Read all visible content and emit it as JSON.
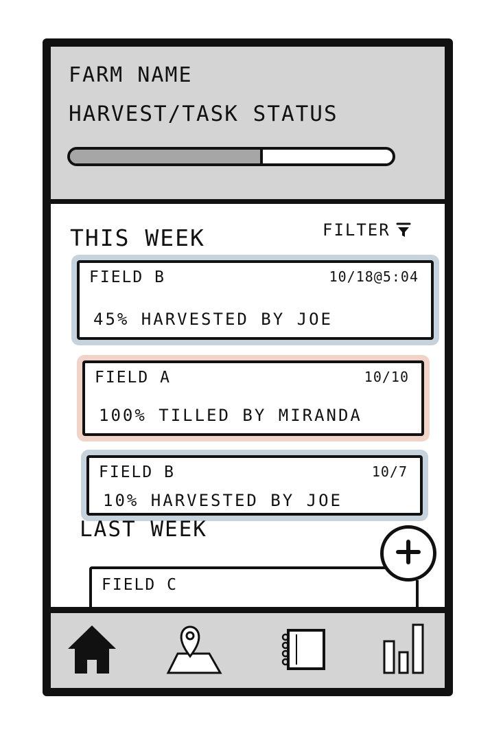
{
  "header": {
    "farm_name": "FARM NAME",
    "status_title": "HARVEST/TASK STATUS",
    "progress_fraction": 0.59
  },
  "this_week": {
    "title": "THIS WEEK",
    "filter_label": "FILTER",
    "filter_icon": "funnel-icon",
    "cards": [
      {
        "field": "FIELD B",
        "date": "10/18@5:04",
        "detail": "45% HARVESTED BY JOE",
        "accent": "#c6d3dc"
      },
      {
        "field": "FIELD A",
        "date": "10/10",
        "detail": "100% TILLED BY MIRANDA",
        "accent": "#f2d3c8"
      },
      {
        "field": "FIELD B",
        "date": "10/7",
        "detail": "10% HARVESTED BY JOE",
        "accent": "#c6d3dc"
      }
    ]
  },
  "last_week": {
    "title": "LAST WEEK",
    "cards": [
      {
        "field": "FIELD C"
      }
    ]
  },
  "add_button_icon": "plus-icon",
  "nav": {
    "items": [
      {
        "icon": "home-icon"
      },
      {
        "icon": "map-pin-icon"
      },
      {
        "icon": "notebook-icon"
      },
      {
        "icon": "bar-chart-icon"
      }
    ]
  },
  "colors": {
    "header_bg": "#d4d4d4",
    "progress_fill": "#a6a6a6",
    "blue_highlight": "#c6d3dc",
    "red_highlight": "#f2d3c8"
  }
}
